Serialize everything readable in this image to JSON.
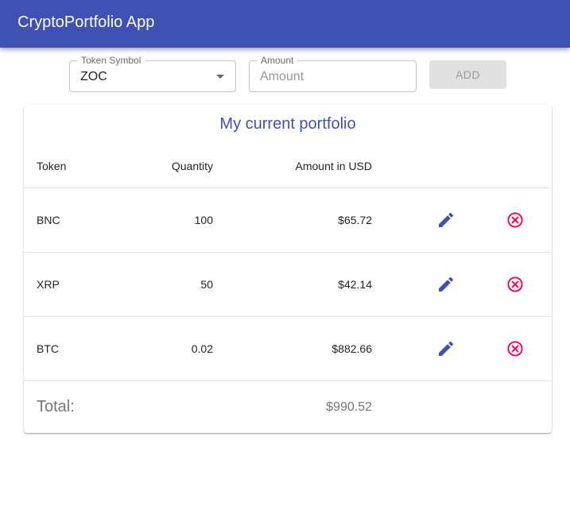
{
  "app": {
    "title": "CryptoPortfolio App"
  },
  "form": {
    "token_symbol": {
      "label": "Token Symbol",
      "value": "ZOC"
    },
    "amount": {
      "label": "Amount",
      "placeholder": "Amount",
      "value": ""
    },
    "add_label": "ADD"
  },
  "portfolio": {
    "title": "My current portfolio",
    "columns": {
      "token": "Token",
      "quantity": "Quantity",
      "usd": "Amount in USD"
    },
    "rows": [
      {
        "token": "BNC",
        "quantity": "100",
        "usd": "$65.72"
      },
      {
        "token": "XRP",
        "quantity": "50",
        "usd": "$42.14"
      },
      {
        "token": "BTC",
        "quantity": "0.02",
        "usd": "$882.66"
      }
    ],
    "total_label": "Total:",
    "total_value": "$990.52"
  },
  "icons": {
    "edit": "pencil-icon",
    "delete": "cancel-circle-icon"
  },
  "colors": {
    "primary": "#3f51b5",
    "delete": "#f50057",
    "disabled_button": "#e0e0e0"
  }
}
